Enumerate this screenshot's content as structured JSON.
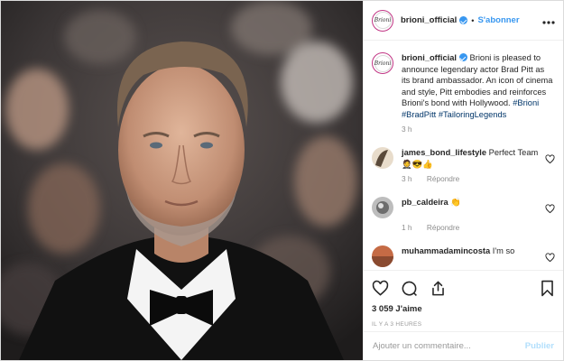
{
  "post": {
    "username": "brioni_official",
    "follow_label": "S'abonner",
    "separator": "•",
    "avatar_text": "Brioni"
  },
  "caption": {
    "username": "brioni_official",
    "text": "Brioni is pleased to announce legendary actor Brad Pitt as its brand ambassador. An icon of cinema and style, Pitt embodies and reinforces Brioni's bond with Hollywood.",
    "hashtags": "#Brioni #BradPitt #TailoringLegends",
    "age": "3 h"
  },
  "comments": [
    {
      "username": "james_bond_lifestyle",
      "text": "Perfect Team 🤵😎👍",
      "age": "3 h",
      "reply_label": "Répondre",
      "avatar_color": "#5a4a3a"
    },
    {
      "username": "pb_caldeira",
      "text": "👏",
      "age": "1 h",
      "reply_label": "Répondre",
      "avatar_color": "#6d6d6d"
    },
    {
      "username": "muhammadamincosta",
      "text": "I'm so",
      "age": "",
      "reply_label": "",
      "avatar_color": "#8a4a30"
    }
  ],
  "engagement": {
    "likes": "3 059 J'aime",
    "timestamp": "IL Y A 3 HEURES"
  },
  "composer": {
    "placeholder": "Ajouter un commentaire...",
    "post_label": "Publier"
  },
  "icons": {
    "more": "more-options-icon",
    "like": "heart-icon",
    "comment": "comment-icon",
    "share": "share-icon",
    "save": "bookmark-icon"
  },
  "colors": {
    "link_blue": "#3897f0",
    "hashtag": "#003569",
    "muted": "#8e8e8e",
    "publish_disabled": "#b2dffc"
  }
}
